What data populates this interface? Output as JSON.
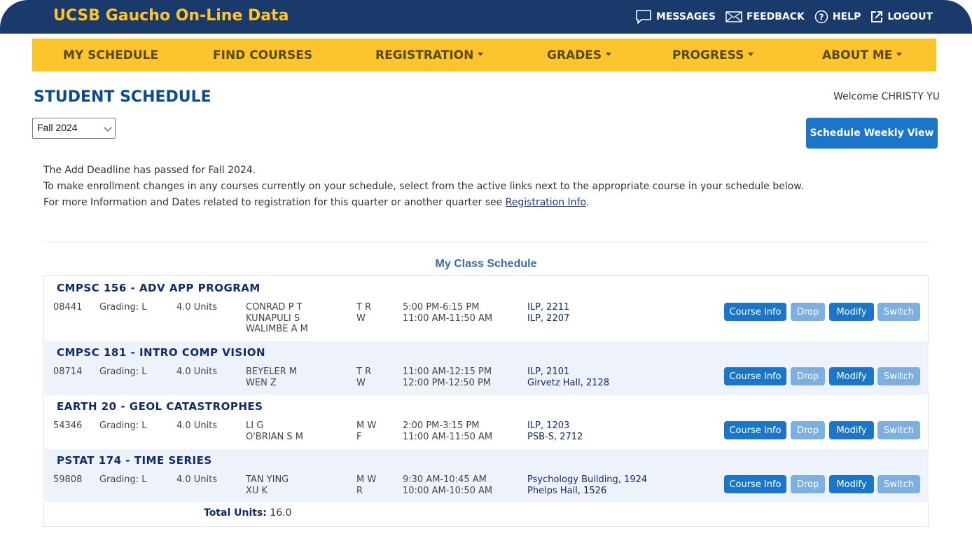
{
  "app": {
    "brand": "UCSB Gaucho On-Line Data",
    "top_links": [
      {
        "label": "MESSAGES",
        "icon": "message-icon"
      },
      {
        "label": "FEEDBACK",
        "icon": "envelope-icon"
      },
      {
        "label": "HELP",
        "icon": "help-icon"
      },
      {
        "label": "LOGOUT",
        "icon": "logout-icon"
      }
    ]
  },
  "nav": [
    {
      "label": "MY SCHEDULE",
      "dropdown": false
    },
    {
      "label": "FIND COURSES",
      "dropdown": false
    },
    {
      "label": "REGISTRATION",
      "dropdown": true
    },
    {
      "label": "GRADES",
      "dropdown": true
    },
    {
      "label": "PROGRESS",
      "dropdown": true
    },
    {
      "label": "ABOUT ME",
      "dropdown": true
    }
  ],
  "page": {
    "title": "STUDENT SCHEDULE",
    "welcome": "Welcome CHRISTY YU",
    "term": "Fall 2024",
    "weekly_button": "Schedule Weekly View"
  },
  "notice": {
    "line1": "The Add Deadline has passed for Fall 2024.",
    "line2": "To make enrollment changes in any courses currently on your schedule, select from the active links next to the appropriate course in your schedule below.",
    "line3_prefix": "For more Information and Dates related to registration for this quarter or another quarter see ",
    "line3_link": "Registration Info",
    "line3_suffix": "."
  },
  "schedule": {
    "title": "My Class Schedule",
    "buttons": {
      "info": "Course Info",
      "drop": "Drop",
      "modify": "Modify",
      "switch": "Switch"
    },
    "courses": [
      {
        "title": "CMPSC 156 - ADV APP PROGRAM",
        "code": "08441",
        "grading": "Grading: L",
        "units": "4.0 Units",
        "instructors": "CONRAD P T\nKUNAPULI S\nWALIMBE A M",
        "days": "T R\nW",
        "times": "5:00 PM-6:15 PM\n11:00 AM-11:50 AM",
        "locations": "ILP, 2211\nILP, 2207"
      },
      {
        "title": "CMPSC 181 - INTRO COMP VISION",
        "code": "08714",
        "grading": "Grading: L",
        "units": "4.0 Units",
        "instructors": "BEYELER M\nWEN Z",
        "days": "T R\nW",
        "times": "11:00 AM-12:15 PM\n12:00 PM-12:50 PM",
        "locations": "ILP, 2101\nGirvetz Hall, 2128"
      },
      {
        "title": "EARTH 20 - GEOL CATASTROPHES",
        "code": "54346",
        "grading": "Grading: L",
        "units": "4.0 Units",
        "instructors": "LI G\nO'BRIAN S M",
        "days": "M W\nF",
        "times": "2:00 PM-3:15 PM\n11:00 AM-11:50 AM",
        "locations": "ILP, 1203\nPSB-S, 2712"
      },
      {
        "title": "PSTAT 174 - TIME SERIES",
        "code": "59808",
        "grading": "Grading: L",
        "units": "4.0 Units",
        "instructors": "TAN YING\nXU K",
        "days": "M W\nR",
        "times": "9:30 AM-10:45 AM\n10:00 AM-10:50 AM",
        "locations": "Psychology Building, 1924\nPhelps Hall, 1526"
      }
    ],
    "total_label": "Total Units:",
    "total_value": "16.0"
  },
  "colors": {
    "topbar": "#1a3a6b",
    "gold": "#fdc52d",
    "primary_button": "#1b75c9",
    "disabled_button": "#7db0e0"
  }
}
